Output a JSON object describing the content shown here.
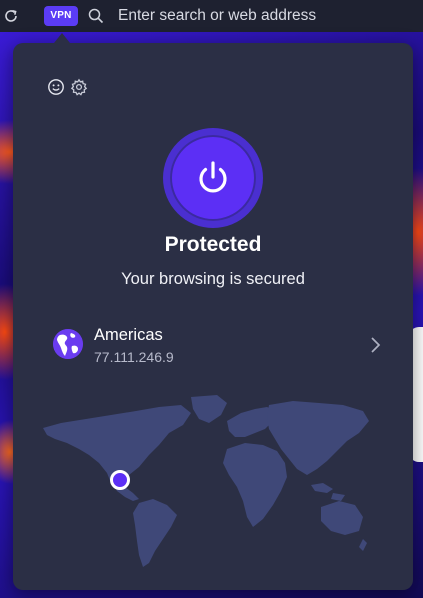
{
  "toolbar": {
    "reload_icon": "reload-icon",
    "vpn_badge": "VPN",
    "search_icon": "search-icon",
    "address_placeholder": "Enter search or web address"
  },
  "popup": {
    "feedback_icon": "smiley-icon",
    "settings_icon": "gear-icon",
    "power_icon": "power-icon",
    "status_title": "Protected",
    "status_subtitle": "Your browsing is secured",
    "location": {
      "name": "Americas",
      "ip": "77.111.246.9",
      "icon": "globe-americas-icon"
    },
    "map_marker_icon": "location-marker-icon"
  },
  "colors": {
    "accent": "#5c2ff5",
    "popup_bg": "#2b2f45",
    "map_land": "#3f4878",
    "text_primary": "#ffffff",
    "text_secondary": "#b7bacb"
  }
}
